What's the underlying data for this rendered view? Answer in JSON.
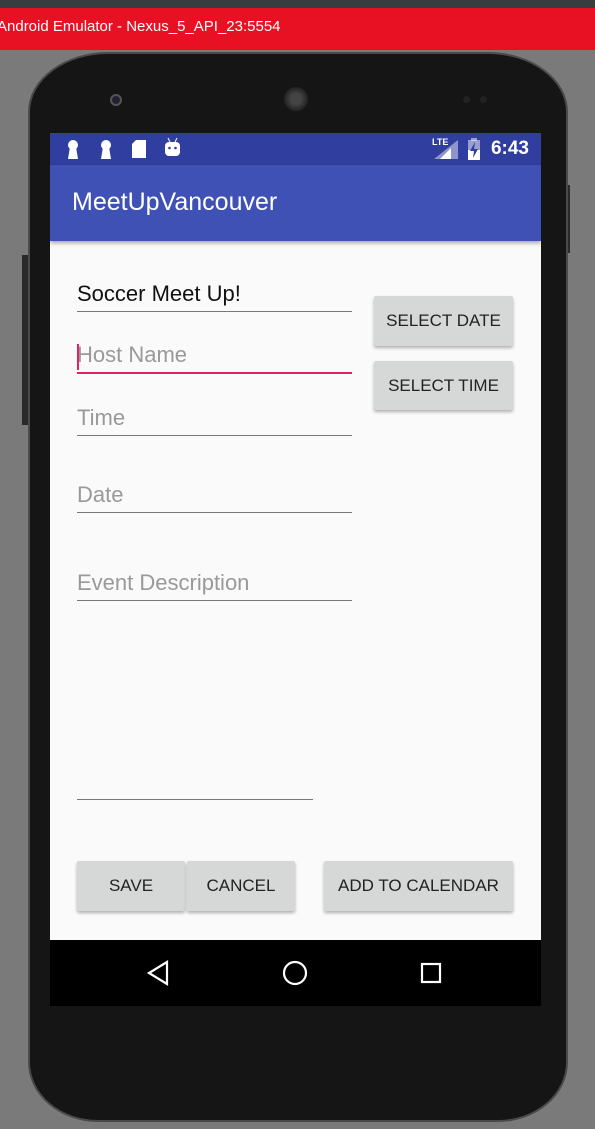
{
  "window": {
    "title": "Android Emulator - Nexus_5_API_23:5554"
  },
  "status_bar": {
    "time": "6:43",
    "network": "LTE",
    "icons": [
      "keyhole-icon",
      "keyhole-icon",
      "sd-card-icon",
      "android-icon",
      "signal-icon",
      "battery-charging-icon"
    ]
  },
  "app_bar": {
    "title": "MeetUpVancouver"
  },
  "form": {
    "title_value": "Soccer Meet Up!",
    "host_placeholder": "Host Name",
    "time_placeholder": "Time",
    "date_placeholder": "Date",
    "description_placeholder": "Event Description"
  },
  "buttons": {
    "select_date": "SELECT DATE",
    "select_time": "SELECT TIME",
    "save": "SAVE",
    "cancel": "CANCEL",
    "add_to_calendar": "ADD TO CALENDAR"
  },
  "colors": {
    "primary": "#3f51b5",
    "primary_dark": "#303f9f",
    "accent": "#e91e63",
    "window_bar": "#e81123"
  }
}
